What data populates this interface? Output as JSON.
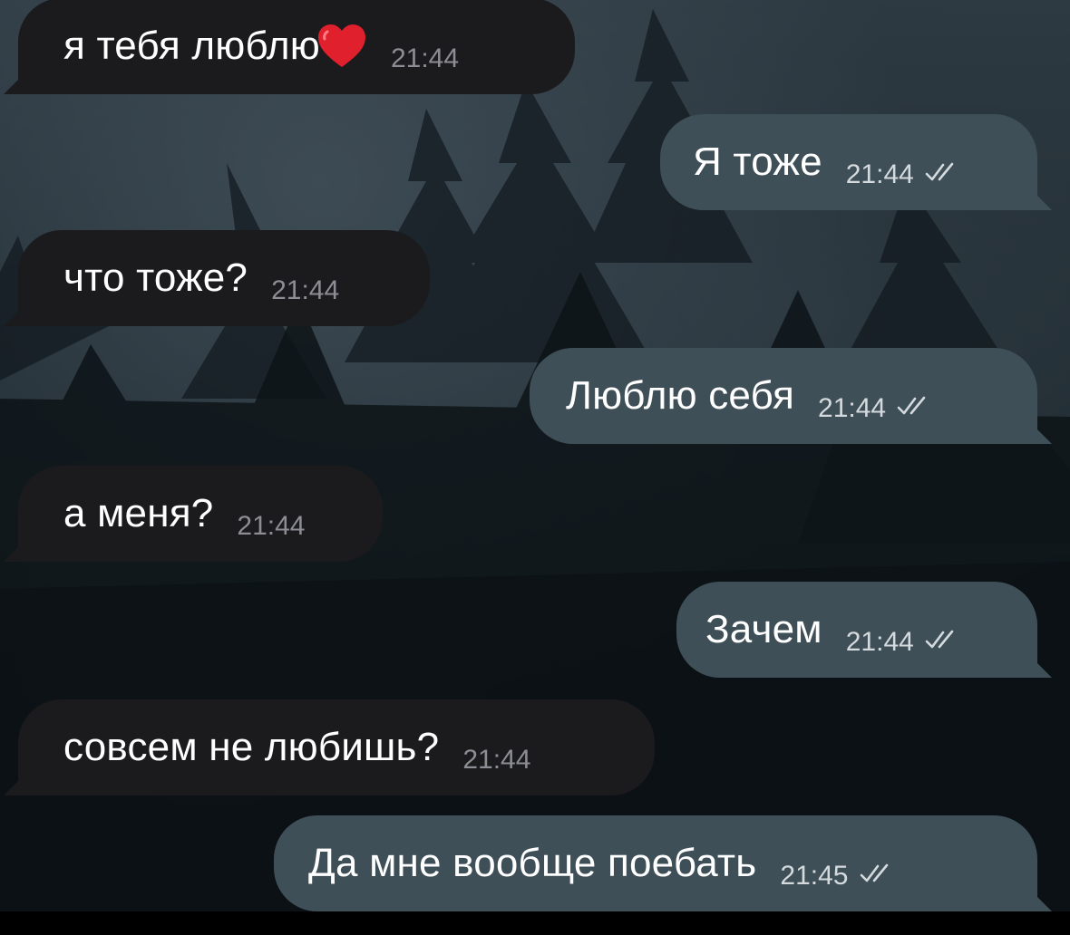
{
  "chat": {
    "messages": [
      {
        "direction": "incoming",
        "text": "я тебя люблю",
        "emoji": "heart-icon",
        "time": "21:44"
      },
      {
        "direction": "outgoing",
        "text": "Я тоже",
        "time": "21:44",
        "status": "read"
      },
      {
        "direction": "incoming",
        "text": "что тоже?",
        "time": "21:44"
      },
      {
        "direction": "outgoing",
        "text": "Люблю себя",
        "time": "21:44",
        "status": "read"
      },
      {
        "direction": "incoming",
        "text": "а меня?",
        "time": "21:44"
      },
      {
        "direction": "outgoing",
        "text": "Зачем",
        "time": "21:44",
        "status": "read"
      },
      {
        "direction": "incoming",
        "text": "совсем не любишь?",
        "time": "21:44"
      },
      {
        "direction": "outgoing",
        "text": "Да мне вообще поебать",
        "time": "21:45",
        "status": "read"
      }
    ]
  },
  "colors": {
    "incoming_bubble": "#1b1b1e",
    "outgoing_bubble": "#3f4f57",
    "heart": "#e0202c"
  }
}
